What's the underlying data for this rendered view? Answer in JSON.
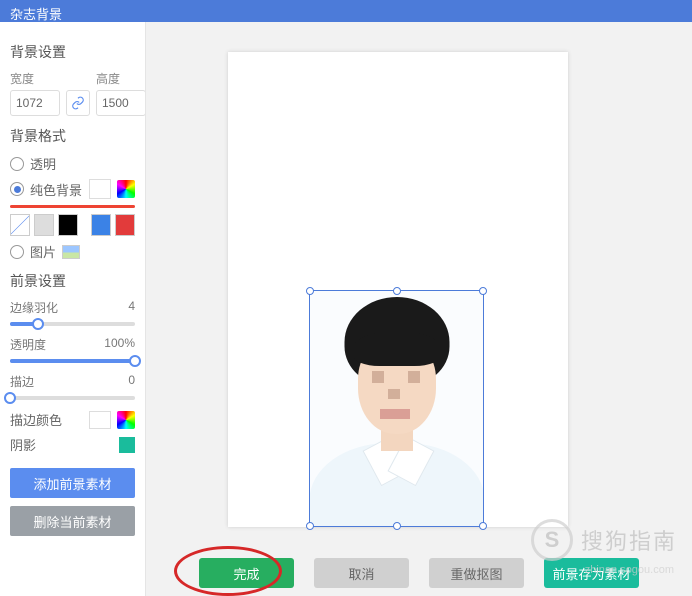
{
  "header": {
    "title": "杂志背景"
  },
  "bg": {
    "section": "背景设置",
    "width_label": "宽度",
    "height_label": "高度",
    "width": "1072",
    "height": "1500",
    "format_section": "背景格式",
    "opt_transparent": "透明",
    "opt_solid": "纯色背景",
    "opt_image": "图片"
  },
  "fg": {
    "section": "前景设置",
    "feather_label": "边缘羽化",
    "feather_value": "4",
    "opacity_label": "透明度",
    "opacity_value": "100%",
    "stroke_label": "描边",
    "stroke_value": "0",
    "stroke_color_label": "描边颜色",
    "shadow_label": "阴影"
  },
  "buttons": {
    "add_fg": "添加前景素材",
    "del_fg": "删除当前素材"
  },
  "footer": {
    "done": "完成",
    "cancel": "取消",
    "redo": "重做抠图",
    "save_fg": "前景存为素材"
  },
  "watermark": {
    "brand": "搜狗指南",
    "initial": "S",
    "url": "zhinan.sogou.com"
  }
}
